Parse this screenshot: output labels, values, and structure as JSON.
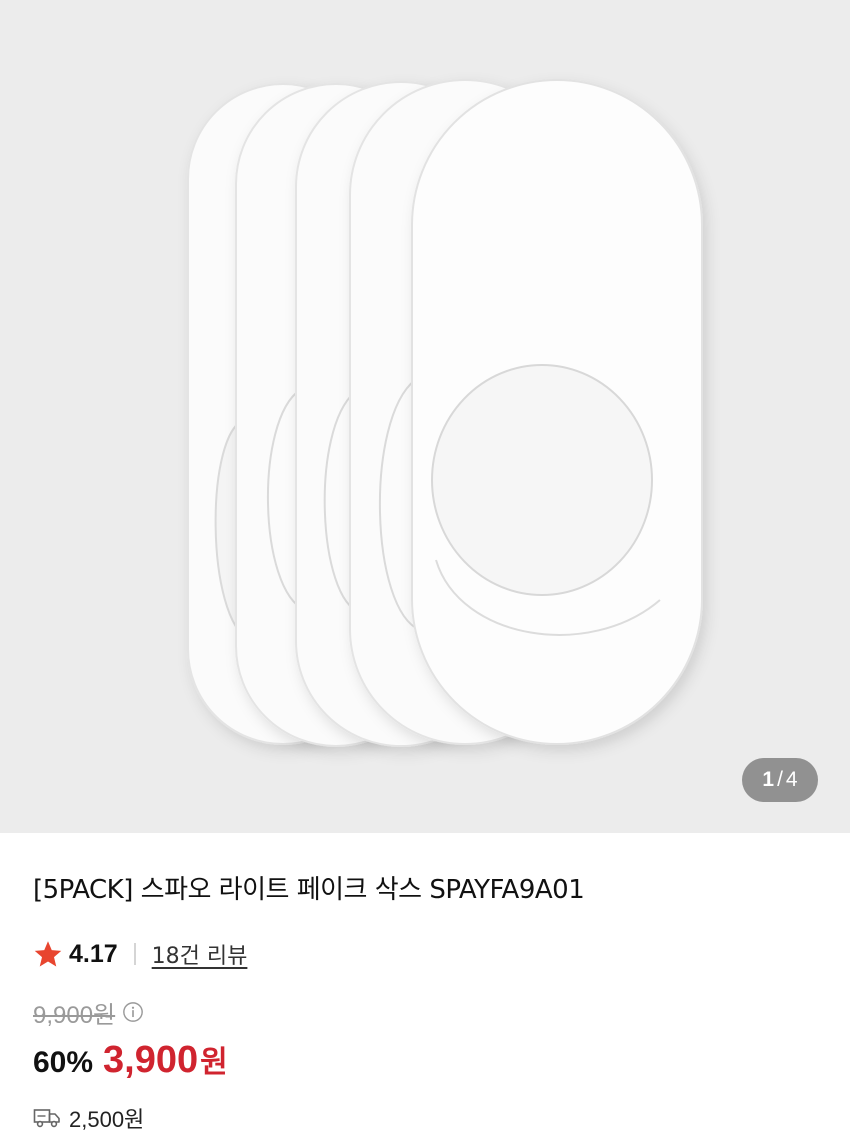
{
  "gallery": {
    "current": "1",
    "separator": "/",
    "total": "4",
    "image_desc": "five white no-show fake socks fanned out"
  },
  "product": {
    "title": "[5PACK] 스파오 라이트 페이크 삭스 SPAYFA9A01",
    "rating": "4.17",
    "review_link": "18건 리뷰",
    "original_price": "9,900원",
    "discount": "60%",
    "sale_price": "3,900",
    "currency": "원",
    "shipping_fee": "2,500원"
  },
  "colors": {
    "star": "#e8452f",
    "sale_price": "#d0242f",
    "background": "#ececec"
  },
  "icons": [
    "star-icon",
    "info-icon",
    "truck-icon"
  ]
}
